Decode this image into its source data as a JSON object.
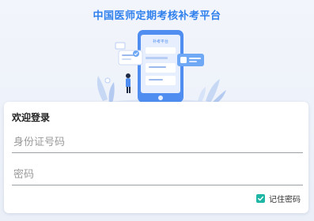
{
  "header": {
    "title": "中国医师定期考核补考平台"
  },
  "illustration": {
    "screen_label": "补考平台",
    "icon": "login-phone-illustration"
  },
  "login_card": {
    "title": "欢迎登录",
    "id_field": {
      "value": "",
      "placeholder": "身份证号码"
    },
    "password_field": {
      "value": "",
      "placeholder": "密码"
    },
    "remember": {
      "label": "记住密码",
      "checked": true
    }
  },
  "colors": {
    "brand": "#2f80ed",
    "checkbox": "#1fb6a5",
    "background": "#eef2fa"
  }
}
